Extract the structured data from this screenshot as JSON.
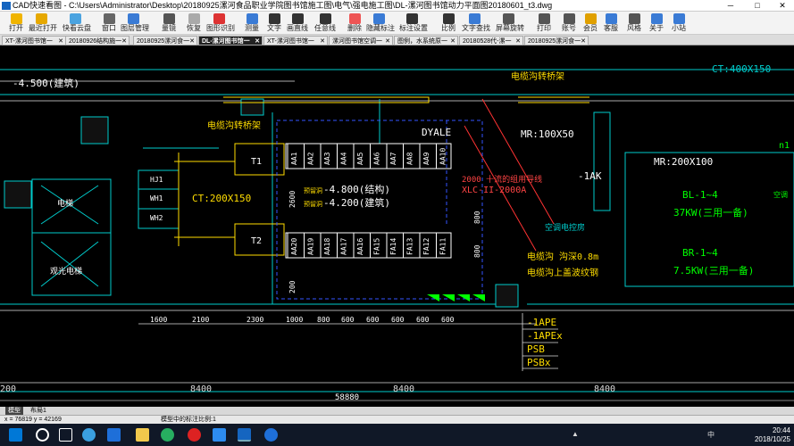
{
  "window": {
    "title": "CAD快速看图 - C:\\Users\\Administrator\\Desktop\\20180925漯河食品职业学院图书馆施工图\\电气\\强电施工图\\DL-漯河图书馆动力平面图20180601_t3.dwg",
    "minimize": "─",
    "maximize": "□",
    "close": "✕"
  },
  "toolbar": [
    {
      "label": "打开",
      "icon": "folder-open-icon",
      "color": "#f0b400"
    },
    {
      "label": "最近打开",
      "icon": "recent-icon",
      "color": "#e6a800"
    },
    {
      "label": "快看云盘",
      "icon": "cloud-icon",
      "color": "#4aa3e0"
    },
    {
      "label": "窗口",
      "icon": "window-icon",
      "color": "#666"
    },
    {
      "label": "图层管理",
      "icon": "layers-icon",
      "color": "#3a7bd5"
    },
    {
      "label": "量镜",
      "icon": "undo-icon",
      "color": "#555"
    },
    {
      "label": "恢复",
      "icon": "redo-icon",
      "color": "#aaa"
    },
    {
      "label": "图形识别",
      "icon": "shape-recognize-icon",
      "color": "#d33"
    },
    {
      "label": "测量",
      "icon": "measure-icon",
      "color": "#3a7bd5"
    },
    {
      "label": "文字",
      "icon": "text-icon",
      "color": "#333"
    },
    {
      "label": "画直线",
      "icon": "line-icon",
      "color": "#333"
    },
    {
      "label": "任意线",
      "icon": "polyline-icon",
      "color": "#333"
    },
    {
      "label": "删除",
      "icon": "eraser-icon",
      "color": "#e55"
    },
    {
      "label": "隐藏标注",
      "icon": "hide-annotation-icon",
      "color": "#3a7bd5"
    },
    {
      "label": "标注设置",
      "icon": "annotation-settings-icon",
      "color": "#333"
    },
    {
      "label": "比例",
      "icon": "scale-icon",
      "color": "#333"
    },
    {
      "label": "文字查找",
      "icon": "text-search-icon",
      "color": "#3a7bd5"
    },
    {
      "label": "屏幕旋转",
      "icon": "rotate-screen-icon",
      "color": "#555"
    },
    {
      "label": "打印",
      "icon": "print-icon",
      "color": "#555"
    },
    {
      "label": "账号",
      "icon": "account-icon",
      "color": "#555"
    },
    {
      "label": "会员",
      "icon": "vip-icon",
      "color": "#e0a000"
    },
    {
      "label": "客服",
      "icon": "support-icon",
      "color": "#3a7bd5"
    },
    {
      "label": "风格",
      "icon": "style-icon",
      "color": "#555"
    },
    {
      "label": "关于",
      "icon": "info-icon",
      "color": "#3a7bd5"
    },
    {
      "label": "小站",
      "icon": "site-icon",
      "color": "#3a7bd5"
    }
  ],
  "tabs": [
    {
      "label": "XT-漯河图书馆一"
    },
    {
      "label": "20180926结构施一"
    },
    {
      "label": "20180925漯河食一"
    },
    {
      "label": "DL-漯河图书馆一",
      "active": true
    },
    {
      "label": "XT-漯河图书馆一"
    },
    {
      "label": "漯河图书馆空调一"
    },
    {
      "label": "图例，水系统原一"
    },
    {
      "label": "20180528代-漯一"
    },
    {
      "label": "20180925漯河食一"
    }
  ],
  "drawing": {
    "elev": "-4.500(建筑)",
    "cable_tray_1": "电缆沟转桥架",
    "cable_tray_2": "电缆沟转桥架",
    "ct400": "CT:400X150",
    "ct200": "CT:200X150",
    "mr100": "MR:100X50",
    "mr200": "MR:200X100",
    "dyale": "DYALE",
    "note_2000": "2000 十流的组用导线",
    "xlc": "XLC-II-2000A",
    "lak": "-1AK",
    "kongtiao": "空调电控房",
    "gou1": "电缆沟 沟深0.8m",
    "gou2": "电缆沟上盖波纹钢",
    "bl": "BL-1~4",
    "bl_kw": "37KW(三用一备)",
    "br": "BR-1~4",
    "br_kw": "7.5KW(三用一备)",
    "struct": "-4.800(结构)",
    "build": "-4.200(建筑)",
    "trans1": "T1",
    "trans2": "T2",
    "jjm1": "预留洞",
    "jjm2": "预留洞",
    "elevator": "电梯",
    "sight_elev": "观光电梯",
    "hj1": "HJ1",
    "wh1": "WH1",
    "wh2": "WH2",
    "ape1": "-1APE",
    "ape2": "-1APEx",
    "psb": "PSB",
    "psbx": "PSBx",
    "n1": "n1",
    "kongtiao2": "空调",
    "panels_top": [
      "AA1",
      "AA2",
      "AA3",
      "AA4",
      "AA5",
      "AA6",
      "AA7",
      "AA8",
      "AA9",
      "AA10"
    ],
    "panels_bot": [
      "AA20",
      "AA19",
      "AA18",
      "AA17",
      "AA16",
      "FA15",
      "FA14",
      "FA13",
      "FA12",
      "FA11"
    ],
    "dims_small": [
      "1600",
      "2100",
      "2300",
      "1000",
      "800",
      "600",
      "600",
      "600",
      "600",
      "600"
    ],
    "dims_big": [
      "8400",
      "8400",
      "8400"
    ],
    "total": "58880",
    "dim_v1": "2600",
    "dim_v2": "800",
    "dim_v3": "200",
    "dim_v4": "800",
    "dim_left": "200"
  },
  "layout_tabs": {
    "model": "模型",
    "layout1": "布局1"
  },
  "status": {
    "coords": "x = 76819  y = 42169",
    "scale": "模型中的标注比例:1"
  },
  "clock": {
    "time": "20:44",
    "date": "2018/10/25",
    "ime": "中"
  }
}
